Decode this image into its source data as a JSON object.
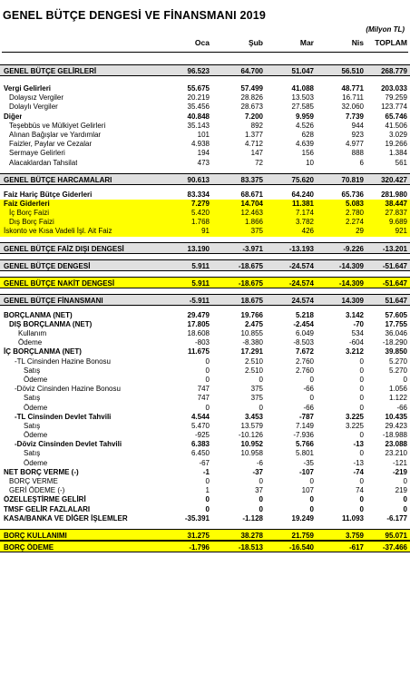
{
  "title": "GENEL BÜTÇE DENGESİ VE FİNANSMANI 2019",
  "unit": "(Milyon TL)",
  "columns": [
    "Oca",
    "Şub",
    "Mar",
    "Nis",
    "TOPLAM"
  ],
  "rows": [
    {
      "t": "gap2"
    },
    {
      "label": "GENEL BÜTÇE GELİRLERİ",
      "v": [
        "96.523",
        "64.700",
        "51.047",
        "56.510",
        "268.779"
      ],
      "s": "sec"
    },
    {
      "t": "gap2"
    },
    {
      "label": "Vergi Gelirleri",
      "v": [
        "55.675",
        "57.499",
        "41.088",
        "48.771",
        "203.033"
      ],
      "s": "b"
    },
    {
      "label": "Dolaysız Vergiler",
      "v": [
        "20.219",
        "28.826",
        "13.503",
        "16.711",
        "79.259"
      ],
      "s": "l1"
    },
    {
      "label": "Dolaylı Vergiler",
      "v": [
        "35.456",
        "28.673",
        "27.585",
        "32.060",
        "123.774"
      ],
      "s": "l1"
    },
    {
      "label": "Diğer",
      "v": [
        "40.848",
        "7.200",
        "9.959",
        "7.739",
        "65.746"
      ],
      "s": "b"
    },
    {
      "label": "Teşebbüs ve Mülkiyet Gelirleri",
      "v": [
        "35.143",
        "892",
        "4.526",
        "944",
        "41.506"
      ],
      "s": "l1"
    },
    {
      "label": "Alınan Bağışlar ve Yardımlar",
      "v": [
        "101",
        "1.377",
        "628",
        "923",
        "3.029"
      ],
      "s": "l1"
    },
    {
      "label": "Faizler, Paylar ve Cezalar",
      "v": [
        "4.938",
        "4.712",
        "4.639",
        "4.977",
        "19.266"
      ],
      "s": "l1"
    },
    {
      "label": "Sermaye Gelirleri",
      "v": [
        "194",
        "147",
        "156",
        "888",
        "1.384"
      ],
      "s": "l1"
    },
    {
      "label": "Alacaklardan Tahsilat",
      "v": [
        "473",
        "72",
        "10",
        "6",
        "561"
      ],
      "s": "l1"
    },
    {
      "t": "gap"
    },
    {
      "label": "GENEL BÜTÇE HARCAMALARI",
      "v": [
        "90.613",
        "83.375",
        "75.620",
        "70.819",
        "320.427"
      ],
      "s": "sec"
    },
    {
      "t": "gap"
    },
    {
      "label": "Faiz Hariç Bütçe Giderleri",
      "v": [
        "83.334",
        "68.671",
        "64.240",
        "65.736",
        "281.980"
      ],
      "s": "b"
    },
    {
      "label": "Faiz Giderleri",
      "v": [
        "7.279",
        "14.704",
        "11.381",
        "5.083",
        "38.447"
      ],
      "s": "b y"
    },
    {
      "label": "İç Borç Faizi",
      "v": [
        "5.420",
        "12.463",
        "7.174",
        "2.780",
        "27.837"
      ],
      "s": "l1 y"
    },
    {
      "label": "Dış Borç Faizi",
      "v": [
        "1.768",
        "1.866",
        "3.782",
        "2.274",
        "9.689"
      ],
      "s": "l1 y"
    },
    {
      "label": "İskonto ve Kısa Vadeli İşl. Ait Faiz",
      "v": [
        "91",
        "375",
        "426",
        "29",
        "921"
      ],
      "s": "y"
    },
    {
      "t": "gap"
    },
    {
      "label": "GENEL BÜTÇE FAİZ DIŞI DENGESİ",
      "v": [
        "13.190",
        "-3.971",
        "-13.193",
        "-9.226",
        "-13.201"
      ],
      "s": "sec"
    },
    {
      "t": "gap"
    },
    {
      "label": "GENEL BÜTÇE DENGESİ",
      "v": [
        "5.911",
        "-18.675",
        "-24.574",
        "-14.309",
        "-51.647"
      ],
      "s": "sec"
    },
    {
      "t": "gap"
    },
    {
      "label": "GENEL BÜTÇE NAKİT DENGESİ",
      "v": [
        "5.911",
        "-18.675",
        "-24.574",
        "-14.309",
        "-51.647"
      ],
      "s": "sec y"
    },
    {
      "t": "gap"
    },
    {
      "label": "GENEL BÜTÇE FİNANSMANI",
      "v": [
        "-5.911",
        "18.675",
        "24.574",
        "14.309",
        "51.647"
      ],
      "s": "sec"
    },
    {
      "t": "gap"
    },
    {
      "label": "BORÇLANMA (NET)",
      "v": [
        "29.479",
        "19.766",
        "5.218",
        "3.142",
        "57.605"
      ],
      "s": "b"
    },
    {
      "label": "DIŞ BORÇLANMA (NET)",
      "v": [
        "17.805",
        "2.475",
        "-2.454",
        "-70",
        "17.755"
      ],
      "s": "b l1"
    },
    {
      "label": "Kullanım",
      "v": [
        "18.608",
        "10.855",
        "6.049",
        "534",
        "36.046"
      ],
      "s": "l2"
    },
    {
      "label": "Ödeme",
      "v": [
        "-803",
        "-8.380",
        "-8.503",
        "-604",
        "-18.290"
      ],
      "s": "l2"
    },
    {
      "label": "İÇ BORÇLANMA (NET)",
      "v": [
        "11.675",
        "17.291",
        "7.672",
        "3.212",
        "39.850"
      ],
      "s": "b"
    },
    {
      "label": "-TL Cinsinden Hazine Bonosu",
      "v": [
        "0",
        "2.510",
        "2.760",
        "0",
        "5.270"
      ],
      "s": "l4"
    },
    {
      "label": "Satış",
      "v": [
        "0",
        "2.510",
        "2.760",
        "0",
        "5.270"
      ],
      "s": "l3"
    },
    {
      "label": "Ödeme",
      "v": [
        "0",
        "0",
        "0",
        "0",
        "0"
      ],
      "s": "l3"
    },
    {
      "label": "-Döviz Cinsinden Hazine Bonosu",
      "v": [
        "747",
        "375",
        "-66",
        "0",
        "1.056"
      ],
      "s": "l4"
    },
    {
      "label": "Satış",
      "v": [
        "747",
        "375",
        "0",
        "0",
        "1.122"
      ],
      "s": "l3"
    },
    {
      "label": "Ödeme",
      "v": [
        "0",
        "0",
        "-66",
        "0",
        "-66"
      ],
      "s": "l3"
    },
    {
      "label": "-TL Cinsinden Devlet Tahvili",
      "v": [
        "4.544",
        "3.453",
        "-787",
        "3.225",
        "10.435"
      ],
      "s": "b l4"
    },
    {
      "label": "Satış",
      "v": [
        "5.470",
        "13.579",
        "7.149",
        "3.225",
        "29.423"
      ],
      "s": "l3"
    },
    {
      "label": "Ödeme",
      "v": [
        "-925",
        "-10.126",
        "-7.936",
        "0",
        "-18.988"
      ],
      "s": "l3"
    },
    {
      "label": "-Döviz Cinsinden Devlet Tahvili",
      "v": [
        "6.383",
        "10.952",
        "5.766",
        "-13",
        "23.088"
      ],
      "s": "b l4"
    },
    {
      "label": "Satış",
      "v": [
        "6.450",
        "10.958",
        "5.801",
        "0",
        "23.210"
      ],
      "s": "l3"
    },
    {
      "label": "Ödeme",
      "v": [
        "-67",
        "-6",
        "-35",
        "-13",
        "-121"
      ],
      "s": "l3"
    },
    {
      "label": "NET BORÇ VERME (-)",
      "v": [
        "-1",
        "-37",
        "-107",
        "-74",
        "-219"
      ],
      "s": "b"
    },
    {
      "label": "BORÇ VERME",
      "v": [
        "0",
        "0",
        "0",
        "0",
        "0"
      ],
      "s": "l1"
    },
    {
      "label": "GERİ ÖDEME (-)",
      "v": [
        "1",
        "37",
        "107",
        "74",
        "219"
      ],
      "s": "l1"
    },
    {
      "label": "ÖZELLEŞTİRME GELİRİ",
      "v": [
        "0",
        "0",
        "0",
        "0",
        "0"
      ],
      "s": "b"
    },
    {
      "label": "TMSF GELİR FAZLALARI",
      "v": [
        "0",
        "0",
        "0",
        "0",
        "0"
      ],
      "s": "b"
    },
    {
      "label": "KASA/BANKA VE DİĞER İŞLEMLER",
      "v": [
        "-35.391",
        "-1.128",
        "19.249",
        "11.093",
        "-6.177"
      ],
      "s": "b"
    },
    {
      "t": "gap"
    },
    {
      "label": "BORÇ KULLANIMI",
      "v": [
        "31.275",
        "38.278",
        "21.759",
        "3.759",
        "95.071"
      ],
      "s": "sec y"
    },
    {
      "label": "BORÇ ÖDEME",
      "v": [
        "-1.796",
        "-18.513",
        "-16.540",
        "-617",
        "-37.466"
      ],
      "s": "sec y"
    }
  ]
}
